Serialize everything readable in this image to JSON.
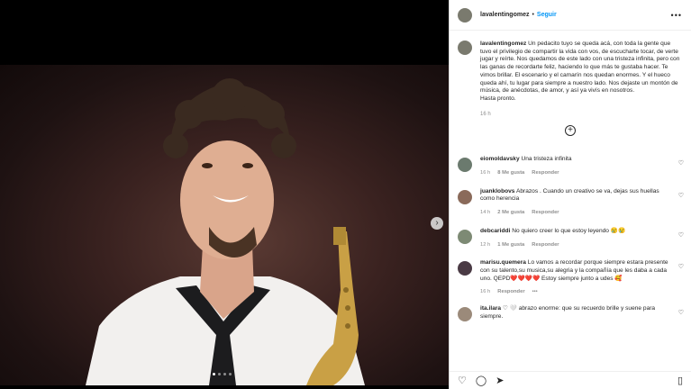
{
  "post": {
    "username": "lavalentingomez",
    "separator": "•",
    "follow_label": "Seguir",
    "more_icon": "•••",
    "caption": "Un pedacito tuyo se queda acá, con toda la gente que tuvo el privilegio de compartir la vida con vos, de escucharte tocar, de verte jugar y reírte. Nos quedamos de este lado con una tristeza infinita, pero con las ganas de recordarte feliz, haciendo lo que más te gustaba hacer. Te vimos brillar. El escenario y el camarín nos quedan enormes. Y el hueco queda ahí, tu lugar para siempre a nuestro lado. Nos dejaste un montón de música, de anécdotas, de amor, y así ya vivís en nosotros.",
    "caption_end": "Hasta pronto.",
    "caption_time": "16 h"
  },
  "comments": [
    {
      "user": "eiomoldavsky",
      "text": "Una tristeza infinita",
      "time": "16 h",
      "likes": "8 Me gusta",
      "reply": "Responder",
      "avatar_color": "#6b7a6e"
    },
    {
      "user": "juanklobovs",
      "text": "Abrazos . Cuando un creativo se va, dejas sus huellas como herencia",
      "time": "14 h",
      "likes": "2 Me gusta",
      "reply": "Responder",
      "avatar_color": "#8a6a5a"
    },
    {
      "user": "debcariddi",
      "text": "No quiero creer lo que estoy leyendo 😢😢",
      "time": "12 h",
      "likes": "1 Me gusta",
      "reply": "Responder",
      "avatar_color": "#7d8a74"
    },
    {
      "user": "marisu.quemera",
      "text": "Lo vamos a recordar porque siempre estara presente con su talento,su musica,su alegria y la compañía que les daba a cada uno. QEPD❤️❤️❤️❤️ Estoy siempre junto a udes 🥰",
      "time": "16 h",
      "likes": "",
      "reply": "Responder",
      "extra": "•••",
      "avatar_color": "#4a3a44"
    },
    {
      "user": "ita.ilara",
      "text": "♡ 🤍 abrazo enorme: que su recuerdo brille y suene para siempre.",
      "time": "",
      "likes": "",
      "reply": "",
      "avatar_color": "#9b8a7a"
    }
  ],
  "ui": {
    "heart_icon": "♡",
    "load_more_icon": "+",
    "next_icon": "›",
    "avatar_color": "#7a7a6e"
  }
}
